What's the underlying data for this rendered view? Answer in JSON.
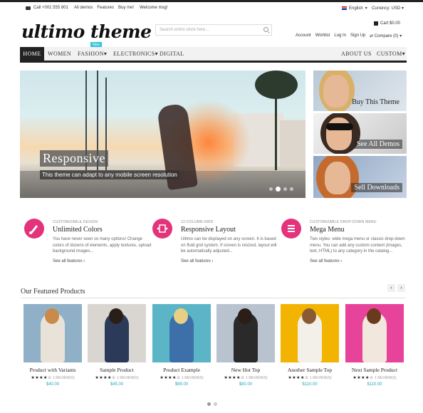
{
  "topbar": {
    "phone": "Call +001 555 801",
    "links": [
      "All demos",
      "Features",
      "Buy me!"
    ],
    "welcome": "Welcome msg!",
    "language": "English",
    "currency": "Currency: USD"
  },
  "header": {
    "logo": "ultimo theme",
    "search_placeholder": "Search entire store here...",
    "cart": "Cart $0.00",
    "account_links": [
      "Account",
      "Wishlist",
      "Log In",
      "Sign Up"
    ],
    "compare": "Compare (0)"
  },
  "nav": {
    "home": "HOME",
    "women": "WOMEN",
    "fashion": "FASHION",
    "electronics": "ELECTRONICS",
    "digital": "DIGITAL",
    "about": "ABOUT US",
    "custom": "CUSTOM",
    "new_badge": "New"
  },
  "hero": {
    "title": "Responsive",
    "subtitle": "This theme can adapt to any mobile screen resolution",
    "slide_count": 4,
    "active_slide": 2
  },
  "side_banners": [
    "Buy This Theme",
    "See All Demos",
    "Sell Downloads"
  ],
  "features": [
    {
      "kicker": "Customizable design",
      "title": "Unlimited Colors",
      "desc": "You have never seen so many options! Change colors of dozens of elements, apply textures, upload background images...",
      "more": "See all features",
      "icon": "brush-icon"
    },
    {
      "kicker": "12-column grid",
      "title": "Responsive Layout",
      "desc": "Ultimo can be displayed on any screen. It is based on fluid grid system. If screen is resized, layout will be automatically adjusted...",
      "more": "See all features",
      "icon": "resize-icon"
    },
    {
      "kicker": "Customizable drop-down menu",
      "title": "Mega Menu",
      "desc": "Two styles: wide mega menu or classic drop-down menu. You can add any custom content (images, text, HTML) to any category in the catalog...",
      "more": "See all features",
      "icon": "menu-icon"
    }
  ],
  "featured": {
    "title": "Our Featured Products",
    "prev": "‹",
    "next": "›",
    "products": [
      {
        "name": "Product with Variants",
        "reviews": "1 REVIEW(S)",
        "price": "$40.00",
        "bg": "#8fb0c6"
      },
      {
        "name": "Sample Product",
        "reviews": "1 REVIEW(S)",
        "price": "$45.00",
        "bg": "#d9d6d2"
      },
      {
        "name": "Product Example",
        "reviews": "1 REVIEW(S)",
        "price": "$99.00",
        "bg": "#5bb5c6"
      },
      {
        "name": "New Hot Top",
        "reviews": "1 REVIEW(S)",
        "price": "$80.00",
        "bg": "#b9c3cf"
      },
      {
        "name": "Another Sample Top",
        "reviews": "1 REVIEW(S)",
        "price": "$110.00",
        "bg": "#f2b400"
      },
      {
        "name": "Next Sample Product",
        "reviews": "1 REVIEW(S)",
        "price": "$110.00",
        "bg": "#e8439a"
      }
    ],
    "stars": "★★★★☆"
  },
  "colors": {
    "accent": "#e3337a",
    "price": "#2aa8c4",
    "nav_active": "#222222",
    "badge": "#34c4d8"
  }
}
